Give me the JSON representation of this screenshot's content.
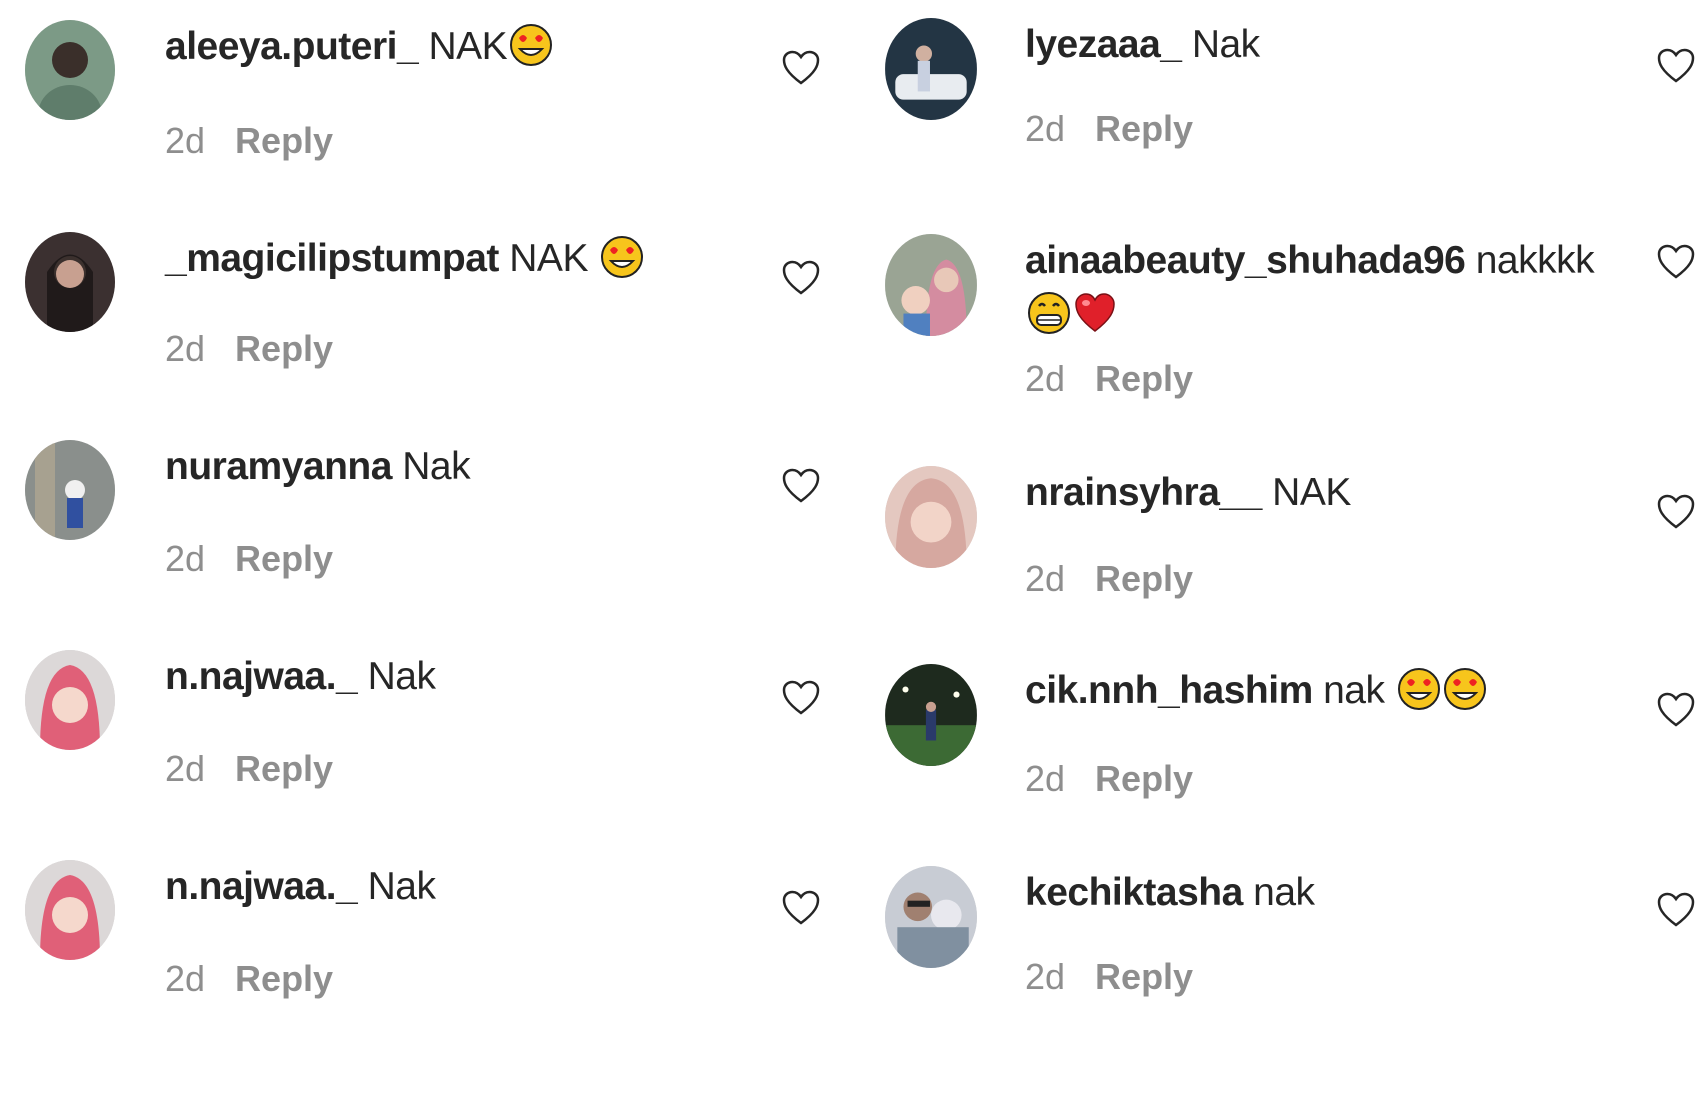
{
  "heart_icon": "heart-outline-icon",
  "left_column": [
    {
      "username": "aleeya.puteri_",
      "text": "NAK",
      "emojis": [
        "heart-eyes"
      ],
      "time": "2d",
      "reply": "Reply",
      "avatar_color": "#7c9a86"
    },
    {
      "username": "_magicilipstumpat",
      "text": "NAK",
      "emojis": [
        "heart-eyes"
      ],
      "time": "2d",
      "reply": "Reply",
      "avatar_color": "#3b3030"
    },
    {
      "username": "nuramyanna",
      "text": "Nak",
      "emojis": [],
      "time": "2d",
      "reply": "Reply",
      "avatar_color": "#8a8f8c"
    },
    {
      "username": "n.najwaa._",
      "text": "Nak",
      "emojis": [],
      "time": "2d",
      "reply": "Reply",
      "avatar_color": "#e07080"
    },
    {
      "username": "n.najwaa._",
      "text": "Nak",
      "emojis": [],
      "time": "2d",
      "reply": "Reply",
      "avatar_color": "#e07080"
    }
  ],
  "right_column": [
    {
      "username": "lyezaaa_",
      "text": "Nak",
      "emojis": [],
      "time": "2d",
      "reply": "Reply",
      "avatar_color": "#233544"
    },
    {
      "username": "ainaabeauty_shuhada96",
      "text": "nakkkk",
      "emojis": [
        "grin",
        "red-heart"
      ],
      "time": "2d",
      "reply": "Reply",
      "avatar_color": "#9aa494"
    },
    {
      "username": "nrainsyhra__",
      "text": "NAK",
      "emojis": [],
      "time": "2d",
      "reply": "Reply",
      "avatar_color": "#d6a8a0"
    },
    {
      "username": "cik.nnh_hashim",
      "text": "nak",
      "emojis": [
        "heart-eyes",
        "heart-eyes"
      ],
      "time": "2d",
      "reply": "Reply",
      "avatar_color": "#2a3a28"
    },
    {
      "username": "kechiktasha",
      "text": "nak",
      "emojis": [],
      "time": "2d",
      "reply": "Reply",
      "avatar_color": "#a4a8b0"
    }
  ]
}
